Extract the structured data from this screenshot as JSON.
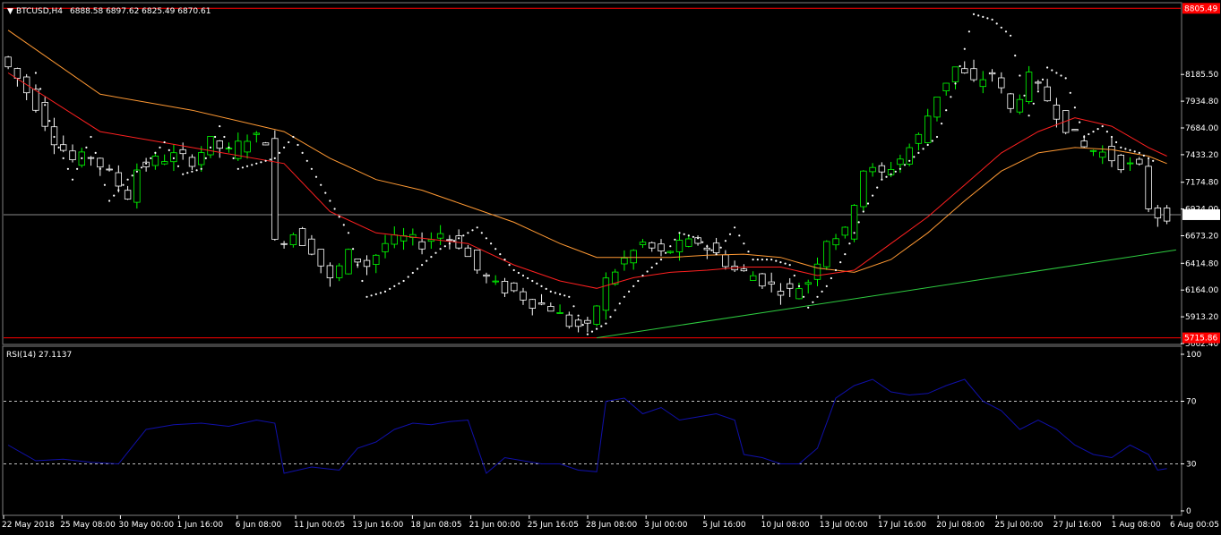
{
  "header": {
    "symbol": "BTCUSD,H4",
    "ohlc": "6888.58 6897.62 6825.49 6870.61"
  },
  "rsi_header": {
    "label": "RSI(14) 27.1137"
  },
  "price_tags": {
    "high": "8805.49",
    "low": "5715.86",
    "current": "6870.61"
  },
  "colors": {
    "background": "#000000",
    "bull": "#00ff00",
    "bear": "#ffffff",
    "ma_fast": "#ff2020",
    "ma_slow": "#ff9933",
    "psar": "#ffffff",
    "trendline": "#2ecc40",
    "level_line": "#ff0000",
    "rsi_line": "#1010aa",
    "grid": "#ffffff"
  },
  "chart_data": [
    {
      "type": "line",
      "name_hint": "price-panel",
      "ylim": [
        5662.4,
        8850
      ],
      "y_ticks": [
        "8185.50",
        "7934.80",
        "7684.00",
        "7433.20",
        "7174.80",
        "6924.00",
        "6673.20",
        "6414.80",
        "6164.00",
        "5913.20",
        "5662.40"
      ],
      "x_ticks": [
        "22 May 2018",
        "25 May 08:00",
        "30 May 00:00",
        "1 Jun 16:00",
        "6 Jun 08:00",
        "11 Jun 00:05",
        "13 Jun 16:00",
        "18 Jun 08:05",
        "21 Jun 00:00",
        "25 Jun 16:05",
        "28 Jun 08:00",
        "3 Jul 00:00",
        "5 Jul 16:00",
        "10 Jul 08:00",
        "13 Jul 00:00",
        "17 Jul 16:00",
        "20 Jul 08:00",
        "25 Jul 00:00",
        "27 Jul 16:00",
        "1 Aug 08:00",
        "6 Aug 00:05"
      ],
      "price_points": [
        [
          0,
          8350
        ],
        [
          2,
          8150
        ],
        [
          4,
          7900
        ],
        [
          6,
          7580
        ],
        [
          8,
          7380
        ],
        [
          10,
          7420
        ],
        [
          12,
          7250
        ],
        [
          14,
          7050
        ],
        [
          15,
          7300
        ],
        [
          17,
          7380
        ],
        [
          19,
          7420
        ],
        [
          21,
          7380
        ],
        [
          23,
          7550
        ],
        [
          25,
          7450
        ],
        [
          27,
          7600
        ],
        [
          29,
          7580
        ],
        [
          30,
          6600
        ],
        [
          32,
          6700
        ],
        [
          34,
          6550
        ],
        [
          36,
          6250
        ],
        [
          38,
          6500
        ],
        [
          40,
          6400
        ],
        [
          42,
          6600
        ],
        [
          44,
          6650
        ],
        [
          46,
          6600
        ],
        [
          48,
          6700
        ],
        [
          50,
          6600
        ],
        [
          52,
          6350
        ],
        [
          54,
          6200
        ],
        [
          56,
          6150
        ],
        [
          58,
          6050
        ],
        [
          60,
          6000
        ],
        [
          62,
          5850
        ],
        [
          64,
          5800
        ],
        [
          66,
          6250
        ],
        [
          68,
          6450
        ],
        [
          70,
          6600
        ],
        [
          72,
          6500
        ],
        [
          74,
          6580
        ],
        [
          76,
          6620
        ],
        [
          78,
          6500
        ],
        [
          80,
          6350
        ],
        [
          82,
          6300
        ],
        [
          84,
          6200
        ],
        [
          86,
          6150
        ],
        [
          88,
          6250
        ],
        [
          90,
          6650
        ],
        [
          92,
          6700
        ],
        [
          94,
          7300
        ],
        [
          96,
          7250
        ],
        [
          98,
          7400
        ],
        [
          100,
          7600
        ],
        [
          102,
          8000
        ],
        [
          104,
          8250
        ],
        [
          106,
          8100
        ],
        [
          108,
          8200
        ],
        [
          110,
          7850
        ],
        [
          112,
          8150
        ],
        [
          114,
          7950
        ],
        [
          116,
          7700
        ],
        [
          118,
          7500
        ],
        [
          120,
          7450
        ],
        [
          122,
          7350
        ],
        [
          124,
          7300
        ],
        [
          125,
          6950
        ],
        [
          126,
          6870
        ]
      ],
      "ma_fast": [
        [
          0,
          8200
        ],
        [
          10,
          7650
        ],
        [
          20,
          7500
        ],
        [
          30,
          7350
        ],
        [
          35,
          6900
        ],
        [
          40,
          6700
        ],
        [
          45,
          6650
        ],
        [
          50,
          6600
        ],
        [
          55,
          6400
        ],
        [
          60,
          6250
        ],
        [
          64,
          6180
        ],
        [
          68,
          6280
        ],
        [
          72,
          6330
        ],
        [
          76,
          6350
        ],
        [
          80,
          6380
        ],
        [
          84,
          6380
        ],
        [
          88,
          6300
        ],
        [
          92,
          6350
        ],
        [
          96,
          6600
        ],
        [
          100,
          6850
        ],
        [
          104,
          7150
        ],
        [
          108,
          7450
        ],
        [
          112,
          7650
        ],
        [
          116,
          7780
        ],
        [
          120,
          7700
        ],
        [
          124,
          7500
        ],
        [
          126,
          7420
        ]
      ],
      "ma_slow": [
        [
          0,
          8600
        ],
        [
          10,
          8000
        ],
        [
          20,
          7850
        ],
        [
          30,
          7650
        ],
        [
          35,
          7400
        ],
        [
          40,
          7200
        ],
        [
          45,
          7100
        ],
        [
          50,
          6950
        ],
        [
          55,
          6800
        ],
        [
          60,
          6600
        ],
        [
          64,
          6470
        ],
        [
          68,
          6470
        ],
        [
          72,
          6470
        ],
        [
          76,
          6490
        ],
        [
          80,
          6500
        ],
        [
          84,
          6470
        ],
        [
          88,
          6370
        ],
        [
          92,
          6330
        ],
        [
          96,
          6450
        ],
        [
          100,
          6700
        ],
        [
          104,
          7000
        ],
        [
          108,
          7280
        ],
        [
          112,
          7450
        ],
        [
          116,
          7500
        ],
        [
          120,
          7480
        ],
        [
          124,
          7420
        ],
        [
          126,
          7350
        ]
      ],
      "psar": [
        [
          3,
          8200
        ],
        [
          5,
          7600
        ],
        [
          7,
          7200
        ],
        [
          9,
          7600
        ],
        [
          11,
          7000
        ],
        [
          13,
          7200
        ],
        [
          15,
          7350
        ],
        [
          17,
          7550
        ],
        [
          19,
          7250
        ],
        [
          21,
          7300
        ],
        [
          23,
          7700
        ],
        [
          25,
          7300
        ],
        [
          27,
          7350
        ],
        [
          29,
          7400
        ],
        [
          31,
          7600
        ],
        [
          33,
          7300
        ],
        [
          35,
          7000
        ],
        [
          37,
          6700
        ],
        [
          39,
          6100
        ],
        [
          41,
          6150
        ],
        [
          43,
          6250
        ],
        [
          45,
          6400
        ],
        [
          47,
          6550
        ],
        [
          49,
          6650
        ],
        [
          51,
          6750
        ],
        [
          53,
          6550
        ],
        [
          55,
          6350
        ],
        [
          57,
          6250
        ],
        [
          59,
          6150
        ],
        [
          61,
          6100
        ],
        [
          63,
          5750
        ],
        [
          65,
          5850
        ],
        [
          67,
          6100
        ],
        [
          69,
          6300
        ],
        [
          71,
          6450
        ],
        [
          73,
          6700
        ],
        [
          75,
          6650
        ],
        [
          77,
          6500
        ],
        [
          79,
          6750
        ],
        [
          81,
          6450
        ],
        [
          83,
          6450
        ],
        [
          85,
          6400
        ],
        [
          87,
          6000
        ],
        [
          89,
          6200
        ],
        [
          91,
          6500
        ],
        [
          93,
          6900
        ],
        [
          95,
          7200
        ],
        [
          97,
          7300
        ],
        [
          99,
          7450
        ],
        [
          101,
          7600
        ],
        [
          103,
          8100
        ],
        [
          105,
          8750
        ],
        [
          107,
          8700
        ],
        [
          109,
          8550
        ],
        [
          111,
          7800
        ],
        [
          113,
          8250
        ],
        [
          115,
          8150
        ],
        [
          117,
          7600
        ],
        [
          119,
          7700
        ],
        [
          121,
          7500
        ],
        [
          123,
          7450
        ],
        [
          125,
          7350
        ]
      ],
      "level_high": 8805.49,
      "level_low": 5715.86,
      "level_current": 6870.61,
      "trendline": [
        [
          64,
          5715.86
        ],
        [
          127,
          6540
        ]
      ]
    },
    {
      "type": "line",
      "name_hint": "rsi-panel",
      "ylim": [
        0,
        100
      ],
      "y_ticks": [
        "100",
        "70",
        "30",
        "0"
      ],
      "levels": [
        70,
        30
      ],
      "rsi": [
        [
          0,
          42
        ],
        [
          3,
          32
        ],
        [
          6,
          33
        ],
        [
          9,
          31
        ],
        [
          12,
          30
        ],
        [
          15,
          52
        ],
        [
          18,
          55
        ],
        [
          21,
          56
        ],
        [
          24,
          54
        ],
        [
          27,
          58
        ],
        [
          29,
          56
        ],
        [
          30,
          24
        ],
        [
          33,
          28
        ],
        [
          36,
          26
        ],
        [
          38,
          40
        ],
        [
          40,
          44
        ],
        [
          42,
          52
        ],
        [
          44,
          56
        ],
        [
          46,
          55
        ],
        [
          48,
          57
        ],
        [
          50,
          58
        ],
        [
          52,
          24
        ],
        [
          54,
          34
        ],
        [
          56,
          32
        ],
        [
          58,
          30
        ],
        [
          60,
          30
        ],
        [
          62,
          26
        ],
        [
          64,
          25
        ],
        [
          65,
          70
        ],
        [
          67,
          72
        ],
        [
          69,
          62
        ],
        [
          71,
          66
        ],
        [
          73,
          58
        ],
        [
          75,
          60
        ],
        [
          77,
          62
        ],
        [
          79,
          58
        ],
        [
          80,
          36
        ],
        [
          82,
          34
        ],
        [
          84,
          30
        ],
        [
          86,
          30
        ],
        [
          88,
          40
        ],
        [
          90,
          72
        ],
        [
          92,
          80
        ],
        [
          94,
          84
        ],
        [
          96,
          76
        ],
        [
          98,
          74
        ],
        [
          100,
          75
        ],
        [
          102,
          80
        ],
        [
          104,
          84
        ],
        [
          106,
          70
        ],
        [
          108,
          64
        ],
        [
          110,
          52
        ],
        [
          112,
          58
        ],
        [
          114,
          52
        ],
        [
          116,
          42
        ],
        [
          118,
          36
        ],
        [
          120,
          34
        ],
        [
          122,
          42
        ],
        [
          124,
          36
        ],
        [
          125,
          26
        ],
        [
          126,
          27
        ]
      ]
    }
  ]
}
